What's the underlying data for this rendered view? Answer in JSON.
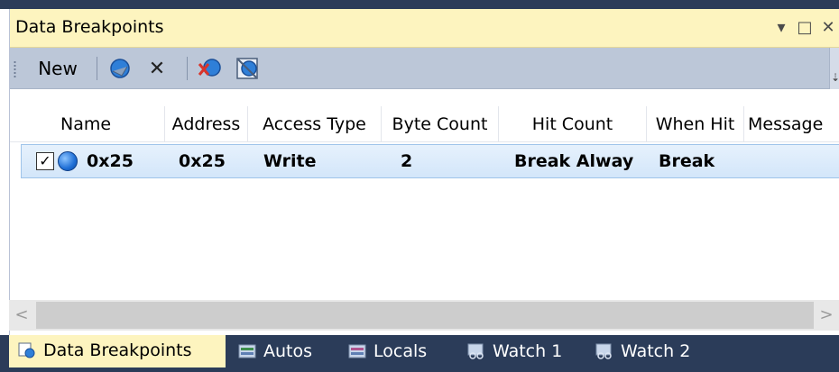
{
  "panel": {
    "title": "Data Breakpoints",
    "controls": [
      "▾",
      "□",
      "✕"
    ]
  },
  "toolbar": {
    "new_label": "New",
    "buttons": [
      "delete-breakpoint-icon",
      "close-icon",
      "delete-all-icon",
      "toggle-all-icon"
    ],
    "overflow_glyph": "⇣"
  },
  "table": {
    "columns": [
      "Name",
      "Address",
      "Access Type",
      "Byte Count",
      "Hit Count",
      "When Hit",
      "Message"
    ],
    "rows": [
      {
        "checked": "✓",
        "name": "0x25",
        "address": "0x25",
        "access_type": "Write",
        "byte_count": "2",
        "hit_count": "Break Alway",
        "when_hit": "Break",
        "message": ""
      }
    ]
  },
  "scrollbar": {
    "left_arrow": "<",
    "right_arrow": ">"
  },
  "tabs": [
    {
      "label": "Data Breakpoints",
      "icon": "data-breakpoints-icon",
      "active": "true"
    },
    {
      "label": "Autos",
      "icon": "autos-icon",
      "active": "false"
    },
    {
      "label": "Locals",
      "icon": "locals-icon",
      "active": "false"
    },
    {
      "label": "Watch 1",
      "icon": "watch-icon",
      "active": "false"
    },
    {
      "label": "Watch 2",
      "icon": "watch-icon",
      "active": "false"
    }
  ],
  "colors": {
    "title_bg": "#fdf4bf",
    "toolbar_bg": "#bcc7d8",
    "selection_bg": "#d3e6fa",
    "tabstrip_bg": "#2b3c59"
  }
}
